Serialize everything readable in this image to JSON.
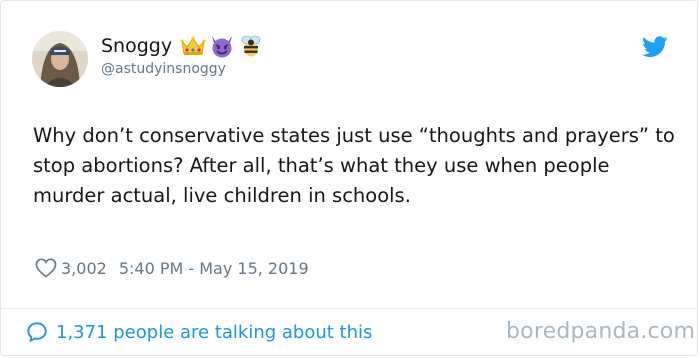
{
  "tweet": {
    "user": {
      "display_name": "Snoggy",
      "handle": "@astudyinsnoggy",
      "name_emojis": [
        "crown-icon",
        "smiling-devil-icon",
        "bee-icon"
      ]
    },
    "text": "Why don’t conservative states just use “thoughts and prayers” to stop abortions? After all, that’s what they use when people murder actual, live children in schools.",
    "likes": "3,002",
    "timestamp": "5:40 PM - May 15, 2019",
    "replies_summary": "1,371 people are talking about this"
  },
  "icons": {
    "twitter": "twitter-bird-icon",
    "like": "heart-icon",
    "replies": "speech-bubble-icon"
  },
  "colors": {
    "twitter_blue": "#1da1f2",
    "link_blue": "#1b95e0",
    "muted_gray": "#657786",
    "text_dark": "#14171a"
  },
  "watermark": "boredpanda.com"
}
